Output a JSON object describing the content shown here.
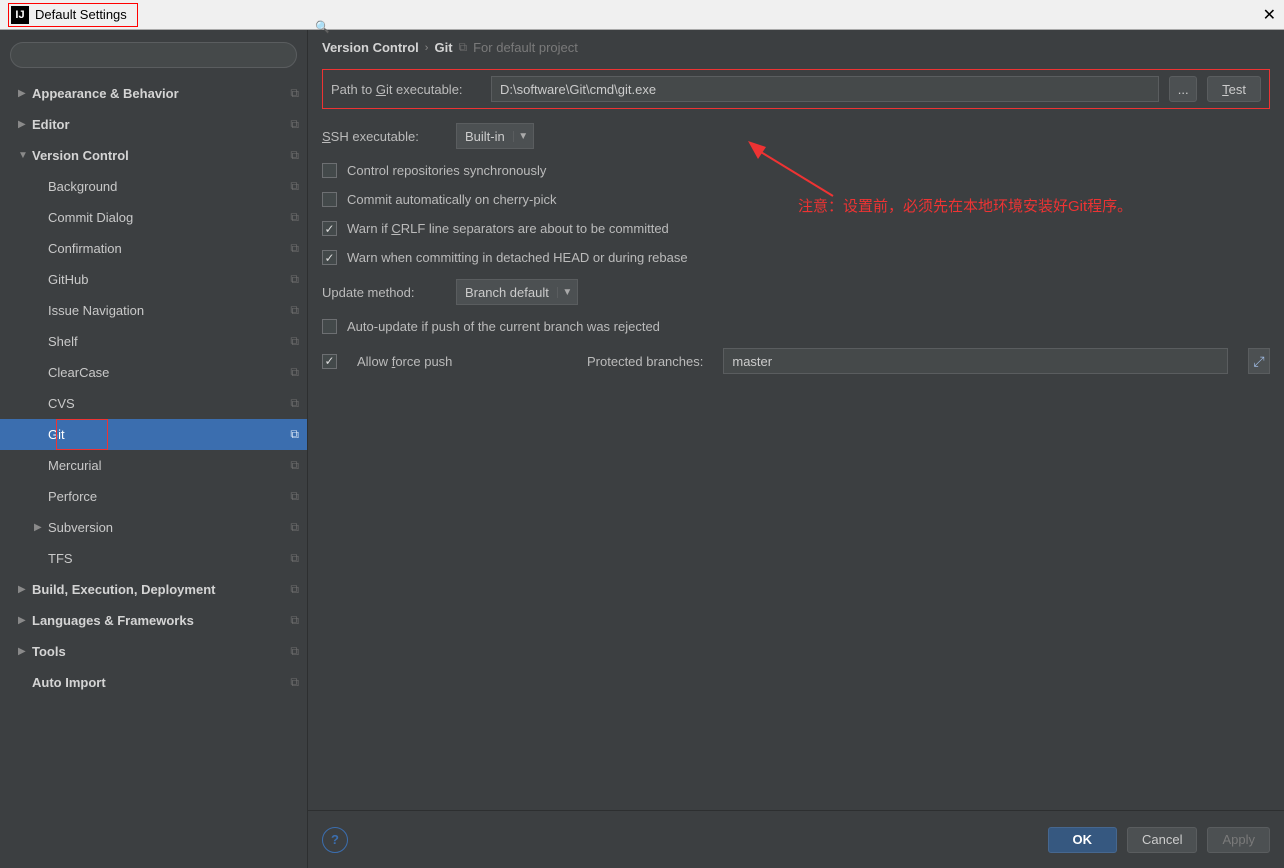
{
  "window": {
    "title": "Default Settings"
  },
  "search": {
    "placeholder": ""
  },
  "tree": {
    "appearance": "Appearance & Behavior",
    "editor": "Editor",
    "version_control": "Version Control",
    "vc_children": {
      "background": "Background",
      "commit_dialog": "Commit Dialog",
      "confirmation": "Confirmation",
      "github": "GitHub",
      "issue_nav": "Issue Navigation",
      "shelf": "Shelf",
      "clearcase": "ClearCase",
      "cvs": "CVS",
      "git": "Git",
      "mercurial": "Mercurial",
      "perforce": "Perforce",
      "subversion": "Subversion",
      "tfs": "TFS"
    },
    "build": "Build, Execution, Deployment",
    "lang": "Languages & Frameworks",
    "tools": "Tools",
    "auto_import": "Auto Import"
  },
  "breadcrumb": {
    "root": "Version Control",
    "leaf": "Git",
    "scope": "For default project"
  },
  "form": {
    "path_label": "Path to Git executable:",
    "path_value": "D:\\software\\Git\\cmd\\git.exe",
    "browse": "...",
    "test": "Test",
    "ssh_label": "SSH executable:",
    "ssh_value": "Built-in",
    "control_sync": "Control repositories synchronously",
    "auto_cherry": "Commit automatically on cherry-pick",
    "warn_crlf": "Warn if CRLF line separators are about to be committed",
    "warn_detached": "Warn when committing in detached HEAD or during rebase",
    "update_method_label": "Update method:",
    "update_method_value": "Branch default",
    "auto_update_push": "Auto-update if push of the current branch was rejected",
    "allow_force_push": "Allow force push",
    "protected_branches_label": "Protected branches:",
    "protected_branches_value": "master"
  },
  "annotation": {
    "text": "注意：设置前，必须先在本地环境安装好Git程序。"
  },
  "footer": {
    "ok": "OK",
    "cancel": "Cancel",
    "apply": "Apply"
  }
}
